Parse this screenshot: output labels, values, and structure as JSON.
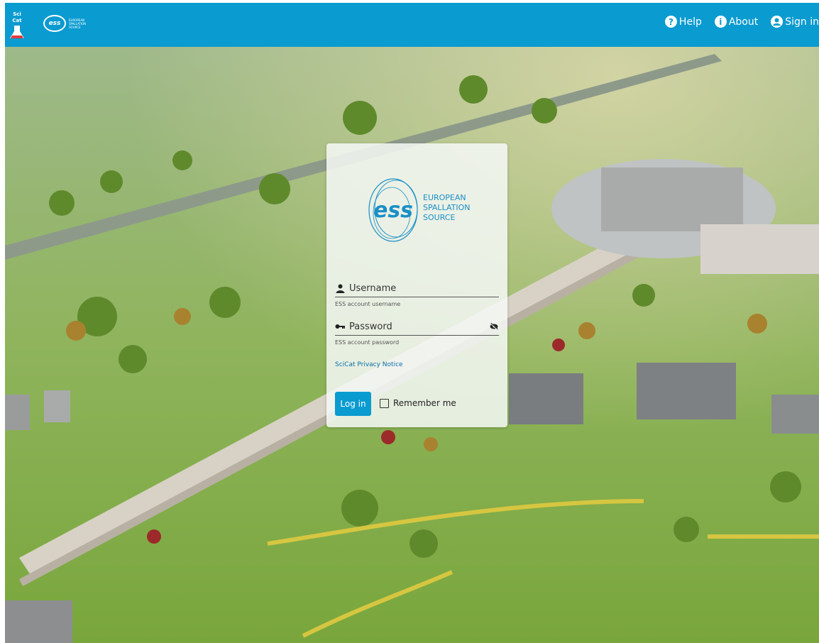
{
  "topbar": {
    "app_logo_text": "SciCat",
    "brand_abbrev": "ess",
    "brand_lines": [
      "EUROPEAN",
      "SPALLATION",
      "SOURCE"
    ],
    "nav": [
      {
        "label": "Help",
        "icon": "help-circle-icon"
      },
      {
        "label": "About",
        "icon": "info-circle-icon"
      },
      {
        "label": "Sign in",
        "icon": "account-circle-icon"
      }
    ],
    "color": "#0a9bd0"
  },
  "login": {
    "logo_abbrev": "ess",
    "logo_lines": [
      "EUROPEAN",
      "SPALLATION",
      "SOURCE"
    ],
    "username_label": "Username",
    "username_hint": "ESS account username",
    "password_label": "Password",
    "password_hint": "ESS account password",
    "privacy_link": "SciCat Privacy Notice",
    "login_button": "Log in",
    "remember_label": "Remember me",
    "remember_checked": false,
    "accent": "#0a9bd0"
  }
}
